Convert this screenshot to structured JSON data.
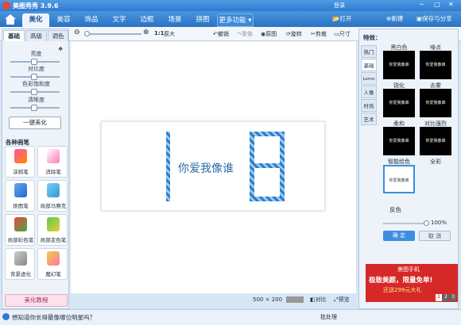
{
  "window": {
    "title": "美图秀秀 3.9.6",
    "login": "登录",
    "controls": [
      "─",
      "□",
      "✕"
    ]
  },
  "menu": {
    "tabs": [
      "美化",
      "美容",
      "饰品",
      "文字",
      "边框",
      "场景",
      "拼图"
    ],
    "more": "更多功能",
    "open": "打开",
    "new": "新建",
    "save": "保存与分享"
  },
  "toolbar": {
    "zoom_label": "1:1",
    "original": "原大",
    "undo": "撤销",
    "redo": "重做",
    "original_image": "原图",
    "rotate": "旋转",
    "crop": "剪裁",
    "size": "尺寸"
  },
  "left": {
    "tabs": [
      "基础",
      "高级",
      "调色"
    ],
    "sliders": [
      {
        "label": "亮度",
        "value": 0.5
      },
      {
        "label": "对比度",
        "value": 0.5
      },
      {
        "label": "色彩饱和度",
        "value": 0.5
      },
      {
        "label": "清晰度",
        "value": 0.5
      }
    ],
    "auto": "一键美化",
    "section": "各种画笔",
    "brushes": [
      "涂鸦笔",
      "消除笔",
      "抠图笔",
      "局部马赛克",
      "局部彩色笔",
      "局部变色笔",
      "背景虚化",
      "魔幻笔"
    ],
    "tutorial": "美化教程"
  },
  "canvas": {
    "text": "你爱我像谁",
    "size_w": "500",
    "size_x": "×",
    "size_h": "200"
  },
  "right": {
    "heading": "特效：",
    "cats": [
      "热门",
      "基础",
      "Lomo",
      "人像",
      "时尚",
      "艺术"
    ],
    "active_cat": 1,
    "effects": [
      {
        "name": "黑白色",
        "thumb": "你爱我像谁"
      },
      {
        "name": "噪点",
        "thumb": "你爱我像谁"
      },
      {
        "name": "锐化",
        "thumb": "你爱我像谁"
      },
      {
        "name": "去雾",
        "thumb": "你爱我像谁"
      },
      {
        "name": "柔和",
        "thumb": "你爱我像谁"
      },
      {
        "name": "对比强烈",
        "thumb": "你爱我像谁"
      },
      {
        "name": "智能绘色",
        "thumb": "你爱我像谁"
      },
      {
        "name": "全彩",
        "thumb": ""
      }
    ],
    "selected": "反色",
    "opacity": "100%",
    "confirm": "确 定",
    "cancel": "取 消",
    "ad_title": "美图手机",
    "ad_line1": "极致美颜，限量免单!",
    "ad_line2": "还送299元大礼",
    "pages": [
      "1",
      "2",
      "3"
    ]
  },
  "status": {
    "tip": "想知道你长得最像哪位明星吗？",
    "compare": "对比",
    "preview": "预览",
    "batch": "批处理"
  },
  "colors": {
    "accent": "#2e7bd0",
    "ad_red": "#d62828"
  }
}
